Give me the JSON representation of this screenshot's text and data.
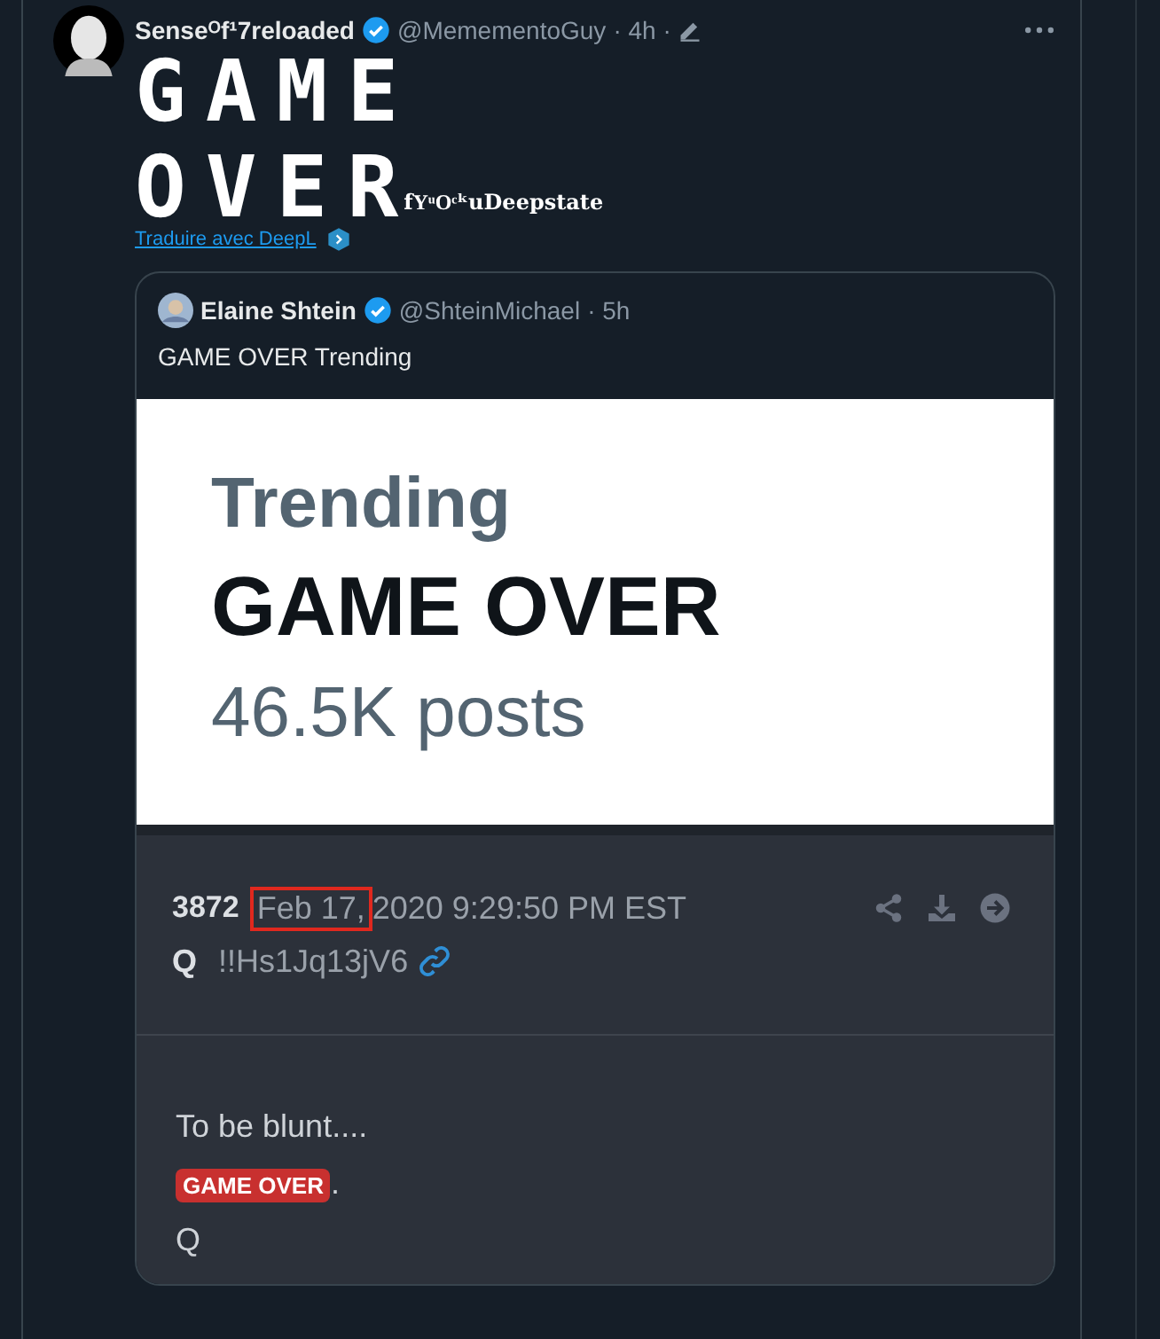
{
  "tweet": {
    "display_name": "Senseᴼf¹7reloaded",
    "verified": true,
    "handle": "@MemementoGuy",
    "time": "· 4h ·",
    "body_lines": [
      "GAME",
      "OVER"
    ],
    "body_suffix": "fYͧOͨᵏuDeepstate",
    "translate_link": "Traduire avec DeepL",
    "quote": {
      "display_name": "Elaine Shtein",
      "verified": true,
      "handle": "@ShteinMichael",
      "time": "· 5h",
      "text": "GAME OVER Trending",
      "image": {
        "trend_label": "Trending",
        "trend_title": "GAME OVER",
        "trend_count": "46.5K posts"
      },
      "post": {
        "number": "3872",
        "date_highlighted": "Feb 17,",
        "date_rest": "2020 9:29:50 PM EST",
        "author": "Q",
        "tripcode": "!!Hs1Jq13jV6",
        "lines": [
          {
            "kind": "text",
            "text": "To be blunt...."
          },
          {
            "kind": "tag",
            "text": "GAME OVER",
            "after": "."
          },
          {
            "kind": "text",
            "text": "Q"
          }
        ]
      }
    }
  }
}
